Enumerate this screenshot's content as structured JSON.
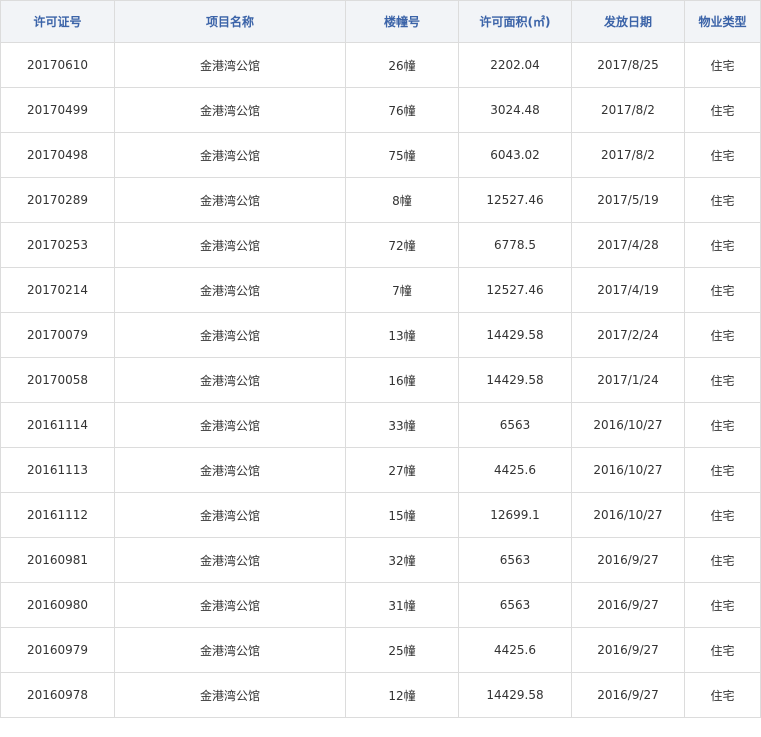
{
  "table": {
    "headers": {
      "permit_no": "许可证号",
      "project_name": "项目名称",
      "building_no": "楼幢号",
      "permit_area": "许可面积(㎡)",
      "issue_date": "发放日期",
      "property_type": "物业类型"
    },
    "rows": [
      {
        "permit_no": "20170610",
        "project_name": "金港湾公馆",
        "building_no": "26幢",
        "permit_area": "2202.04",
        "issue_date": "2017/8/25",
        "property_type": "住宅"
      },
      {
        "permit_no": "20170499",
        "project_name": "金港湾公馆",
        "building_no": "76幢",
        "permit_area": "3024.48",
        "issue_date": "2017/8/2",
        "property_type": "住宅"
      },
      {
        "permit_no": "20170498",
        "project_name": "金港湾公馆",
        "building_no": "75幢",
        "permit_area": "6043.02",
        "issue_date": "2017/8/2",
        "property_type": "住宅"
      },
      {
        "permit_no": "20170289",
        "project_name": "金港湾公馆",
        "building_no": "8幢",
        "permit_area": "12527.46",
        "issue_date": "2017/5/19",
        "property_type": "住宅"
      },
      {
        "permit_no": "20170253",
        "project_name": "金港湾公馆",
        "building_no": "72幢",
        "permit_area": "6778.5",
        "issue_date": "2017/4/28",
        "property_type": "住宅"
      },
      {
        "permit_no": "20170214",
        "project_name": "金港湾公馆",
        "building_no": "7幢",
        "permit_area": "12527.46",
        "issue_date": "2017/4/19",
        "property_type": "住宅"
      },
      {
        "permit_no": "20170079",
        "project_name": "金港湾公馆",
        "building_no": "13幢",
        "permit_area": "14429.58",
        "issue_date": "2017/2/24",
        "property_type": "住宅"
      },
      {
        "permit_no": "20170058",
        "project_name": "金港湾公馆",
        "building_no": "16幢",
        "permit_area": "14429.58",
        "issue_date": "2017/1/24",
        "property_type": "住宅"
      },
      {
        "permit_no": "20161114",
        "project_name": "金港湾公馆",
        "building_no": "33幢",
        "permit_area": "6563",
        "issue_date": "2016/10/27",
        "property_type": "住宅"
      },
      {
        "permit_no": "20161113",
        "project_name": "金港湾公馆",
        "building_no": "27幢",
        "permit_area": "4425.6",
        "issue_date": "2016/10/27",
        "property_type": "住宅"
      },
      {
        "permit_no": "20161112",
        "project_name": "金港湾公馆",
        "building_no": "15幢",
        "permit_area": "12699.1",
        "issue_date": "2016/10/27",
        "property_type": "住宅"
      },
      {
        "permit_no": "20160981",
        "project_name": "金港湾公馆",
        "building_no": "32幢",
        "permit_area": "6563",
        "issue_date": "2016/9/27",
        "property_type": "住宅"
      },
      {
        "permit_no": "20160980",
        "project_name": "金港湾公馆",
        "building_no": "31幢",
        "permit_area": "6563",
        "issue_date": "2016/9/27",
        "property_type": "住宅"
      },
      {
        "permit_no": "20160979",
        "project_name": "金港湾公馆",
        "building_no": "25幢",
        "permit_area": "4425.6",
        "issue_date": "2016/9/27",
        "property_type": "住宅"
      },
      {
        "permit_no": "20160978",
        "project_name": "金港湾公馆",
        "building_no": "12幢",
        "permit_area": "14429.58",
        "issue_date": "2016/9/27",
        "property_type": "住宅"
      }
    ]
  },
  "colors": {
    "header_text": "#3b63a8",
    "header_bg": "#f2f4f7",
    "border": "#dcdcdc",
    "cell_text": "#333333"
  }
}
